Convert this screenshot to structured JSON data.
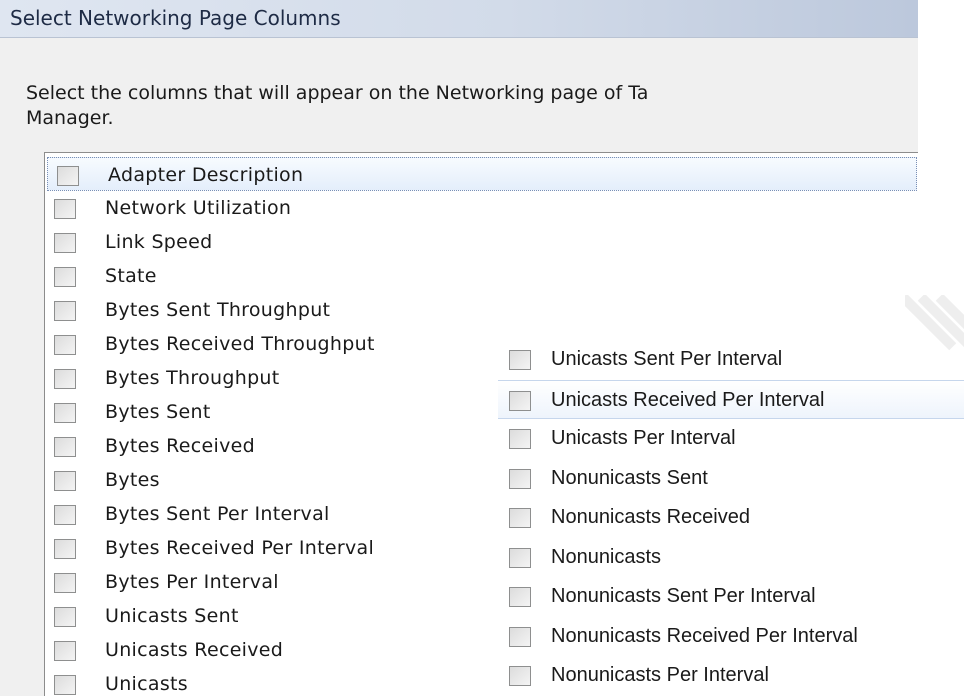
{
  "window": {
    "title": "Select Networking Page Columns"
  },
  "dialog": {
    "description_line1": "Select the columns that will appear on the Networking page of Ta",
    "description_line2": "Manager."
  },
  "columns": [
    {
      "label": "Adapter Description",
      "checked": false,
      "selected": true
    },
    {
      "label": "Network Utilization",
      "checked": false
    },
    {
      "label": "Link Speed",
      "checked": false
    },
    {
      "label": "State",
      "checked": false
    },
    {
      "label": "Bytes Sent Throughput",
      "checked": false
    },
    {
      "label": "Bytes Received Throughput",
      "checked": false
    },
    {
      "label": "Bytes Throughput",
      "checked": false
    },
    {
      "label": "Bytes Sent",
      "checked": false
    },
    {
      "label": "Bytes Received",
      "checked": false
    },
    {
      "label": "Bytes",
      "checked": false
    },
    {
      "label": "Bytes Sent Per Interval",
      "checked": false
    },
    {
      "label": "Bytes Received Per Interval",
      "checked": false
    },
    {
      "label": "Bytes Per Interval",
      "checked": false
    },
    {
      "label": "Unicasts Sent",
      "checked": false
    },
    {
      "label": "Unicasts Received",
      "checked": false
    },
    {
      "label": "Unicasts",
      "checked": false
    }
  ],
  "columns_continued": [
    {
      "label": "Unicasts Sent Per Interval",
      "checked": false
    },
    {
      "label": "Unicasts Received Per Interval",
      "checked": false,
      "hovered": true
    },
    {
      "label": "Unicasts Per Interval",
      "checked": false
    },
    {
      "label": "Nonunicasts Sent",
      "checked": false
    },
    {
      "label": "Nonunicasts Received",
      "checked": false
    },
    {
      "label": "Nonunicasts",
      "checked": false
    },
    {
      "label": "Nonunicasts Sent Per Interval",
      "checked": false
    },
    {
      "label": "Nonunicasts Received Per Interval",
      "checked": false
    },
    {
      "label": "Nonunicasts Per Interval",
      "checked": false
    }
  ],
  "colors": {
    "title_bar": "#d2dbe9",
    "selection": "#e4eefb",
    "dialog_bg": "#f0f0f0"
  }
}
